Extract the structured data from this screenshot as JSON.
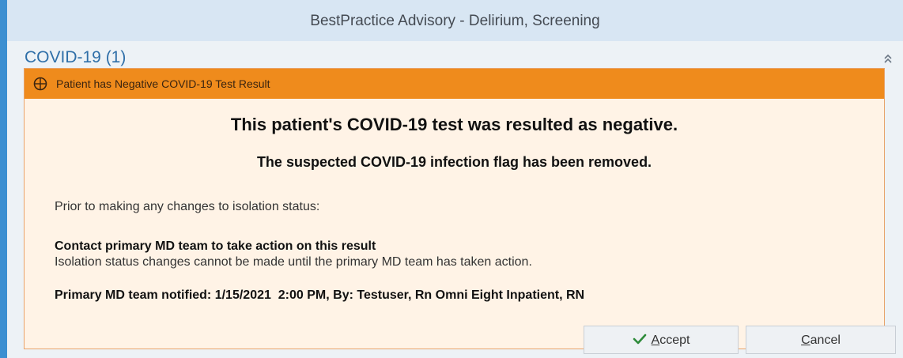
{
  "window": {
    "title": "BestPractice Advisory - Delirium, Screening"
  },
  "section": {
    "title": "COVID-19 (1)"
  },
  "alert": {
    "header": "Patient has Negative COVID-19 Test Result",
    "headline": "This patient's COVID-19 test was resulted as negative.",
    "subheadline": "The suspected COVID-19 infection flag has been removed.",
    "prior_text": "Prior to making any changes to isolation status:",
    "contact_title": "Contact primary MD team to take action on this result",
    "contact_desc": "Isolation status changes cannot be made until the primary MD team has taken action.",
    "notified_text": "Primary MD team notified: 1/15/2021  2:00 PM, By: Testuser, Rn Omni Eight Inpatient, RN"
  },
  "buttons": {
    "accept_first": "A",
    "accept_rest": "ccept",
    "cancel_first": "C",
    "cancel_rest": "ancel"
  },
  "colors": {
    "accent_border": "#3c8fd1",
    "alert_header": "#ef8b1c",
    "alert_body": "#fff3e6",
    "section_title": "#2f6fa8",
    "check_green": "#2e8b3a"
  },
  "icons": {
    "alert": "alert-badge-icon",
    "collapse": "double-chevron-up-icon",
    "accept": "checkmark-icon"
  }
}
